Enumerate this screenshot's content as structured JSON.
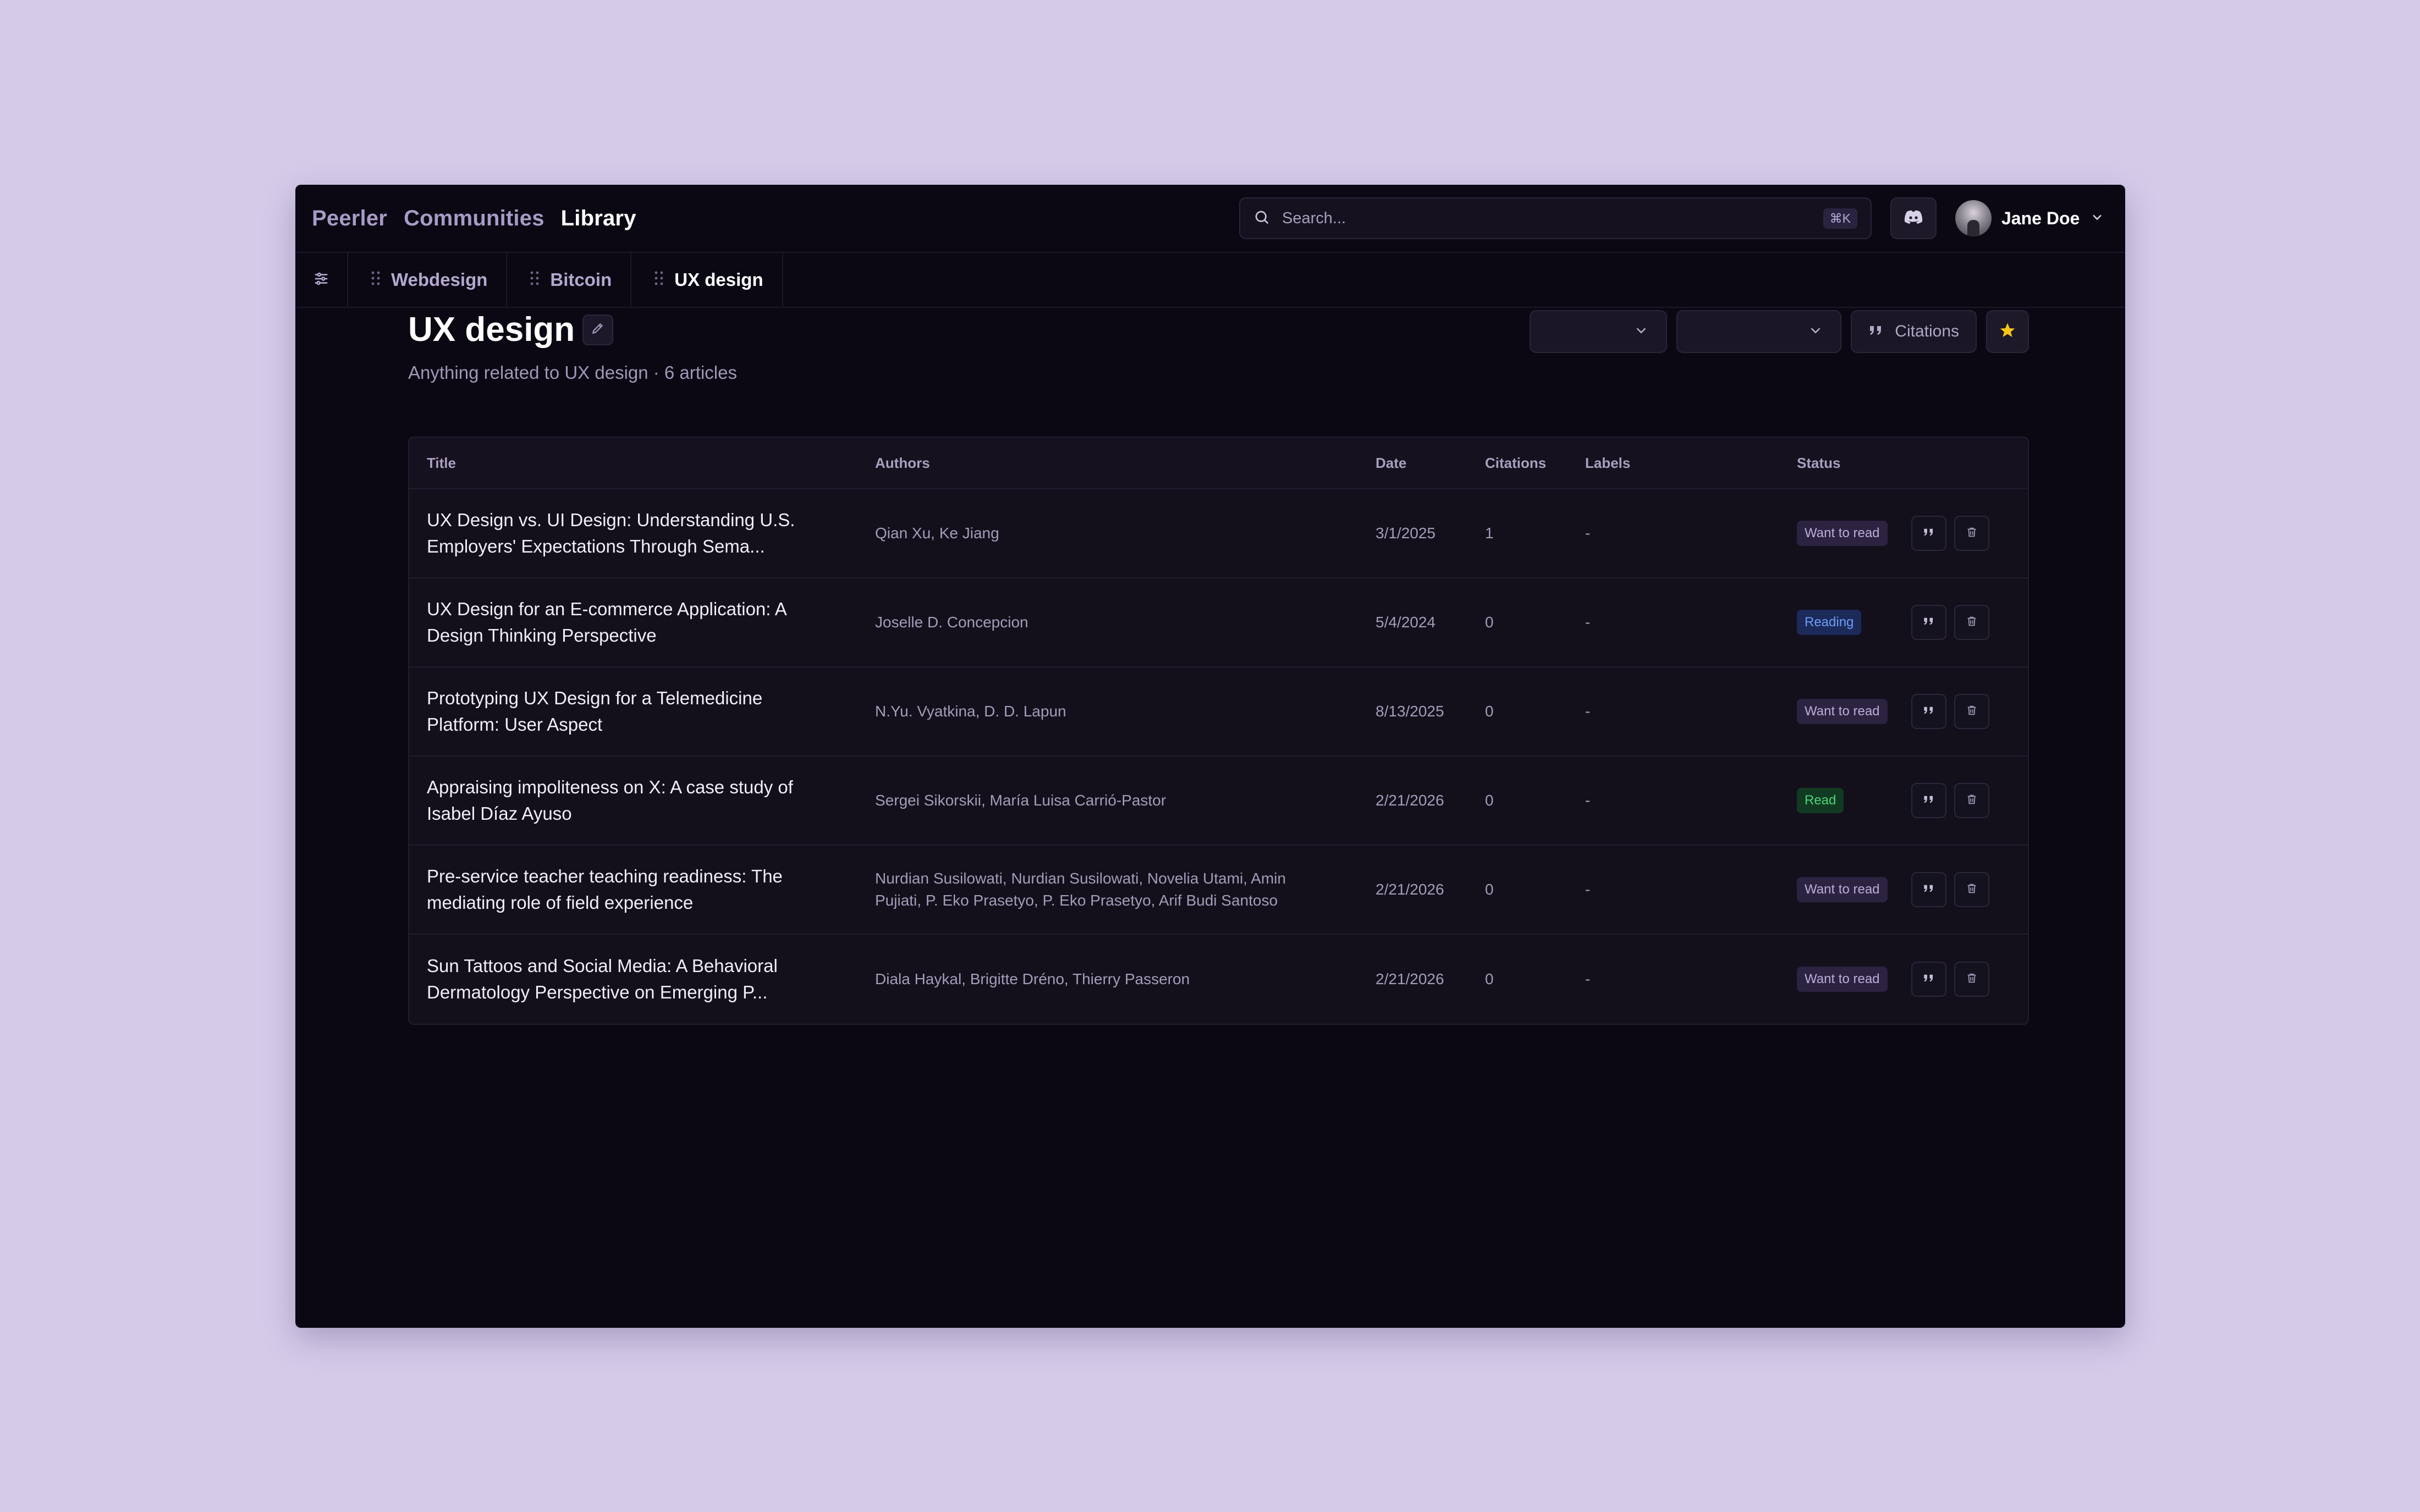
{
  "nav": {
    "brand": "Peerler",
    "communities": "Communities",
    "library": "Library"
  },
  "search": {
    "placeholder": "Search...",
    "shortcut": "⌘K"
  },
  "user": {
    "name": "Jane Doe"
  },
  "tabs": [
    {
      "label": "Webdesign"
    },
    {
      "label": "Bitcoin"
    },
    {
      "label": "UX design"
    }
  ],
  "page": {
    "title": "UX design",
    "subtitle": "Anything related to UX design · 6 articles",
    "citations_label": "Citations"
  },
  "table": {
    "headers": {
      "title": "Title",
      "authors": "Authors",
      "date": "Date",
      "citations": "Citations",
      "labels": "Labels",
      "status": "Status"
    },
    "rows": [
      {
        "title": "UX Design vs. UI Design: Understanding U.S. Employers' Expectations Through Sema...",
        "authors": "Qian Xu, Ke Jiang",
        "date": "3/1/2025",
        "citations": "1",
        "labels": "-",
        "status": "Want to read"
      },
      {
        "title": "UX Design for an E-commerce Application: A Design Thinking Perspective",
        "authors": "Joselle D. Concepcion",
        "date": "5/4/2024",
        "citations": "0",
        "labels": "-",
        "status": "Reading"
      },
      {
        "title": "Prototyping UX Design for a Telemedicine Platform: User Aspect",
        "authors": "N.Yu. Vyatkina, D. D. Lapun",
        "date": "8/13/2025",
        "citations": "0",
        "labels": "-",
        "status": "Want to read"
      },
      {
        "title": "Appraising impoliteness on X: A case study of Isabel Díaz Ayuso",
        "authors": "Sergei Sikorskii, María Luisa Carrió-Pastor",
        "date": "2/21/2026",
        "citations": "0",
        "labels": "-",
        "status": "Read"
      },
      {
        "title": "Pre-service teacher teaching readiness: The mediating role of field experience",
        "authors": "Nurdian Susilowati, Nurdian Susilowati, Novelia Utami, Amin Pujiati, P. Eko Prasetyo, P. Eko Prasetyo, Arif Budi Santoso",
        "date": "2/21/2026",
        "citations": "0",
        "labels": "-",
        "status": "Want to read"
      },
      {
        "title": "Sun Tattoos and Social Media: A Behavioral Dermatology Perspective on Emerging P...",
        "authors": "Diala Haykal, Brigitte Dréno, Thierry Passeron",
        "date": "2/21/2026",
        "citations": "0",
        "labels": "-",
        "status": "Want to read"
      }
    ]
  },
  "colors": {
    "background": "#d5cbe9",
    "window": "#0b0813",
    "star": "#f5c518",
    "status_want": "#b9aedb",
    "status_reading": "#6f9cf5",
    "status_read": "#4ad37a"
  }
}
